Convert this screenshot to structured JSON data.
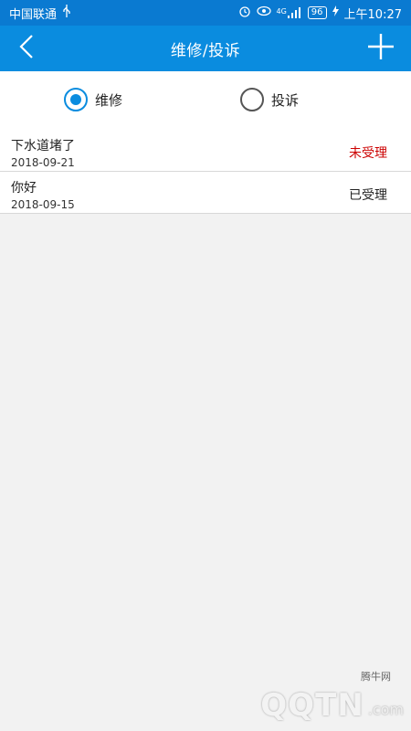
{
  "statusbar": {
    "carrier": "中国联通",
    "usb_icon": "usb-icon",
    "signal_label": "4G",
    "battery": "96",
    "time": "上午10:27"
  },
  "header": {
    "title": "维修/投诉",
    "back_icon": "back-chevron-icon",
    "add_icon": "plus-icon"
  },
  "filter": {
    "options": [
      {
        "label": "维修",
        "checked": true
      },
      {
        "label": "投诉",
        "checked": false
      }
    ]
  },
  "items": [
    {
      "title": "下水道堵了",
      "date": "2018-09-21",
      "status": "未受理",
      "status_color": "#cc0000"
    },
    {
      "title": "你好",
      "date": "2018-09-15",
      "status": "已受理",
      "status_color": "#222222"
    }
  ],
  "watermark": {
    "site": "腾牛网",
    "logo": "QQTN",
    "suffix": ".com"
  },
  "colors": {
    "header": "#0a8cdf",
    "statusbar": "#0a7ad1",
    "accent": "#0a8cdf"
  }
}
